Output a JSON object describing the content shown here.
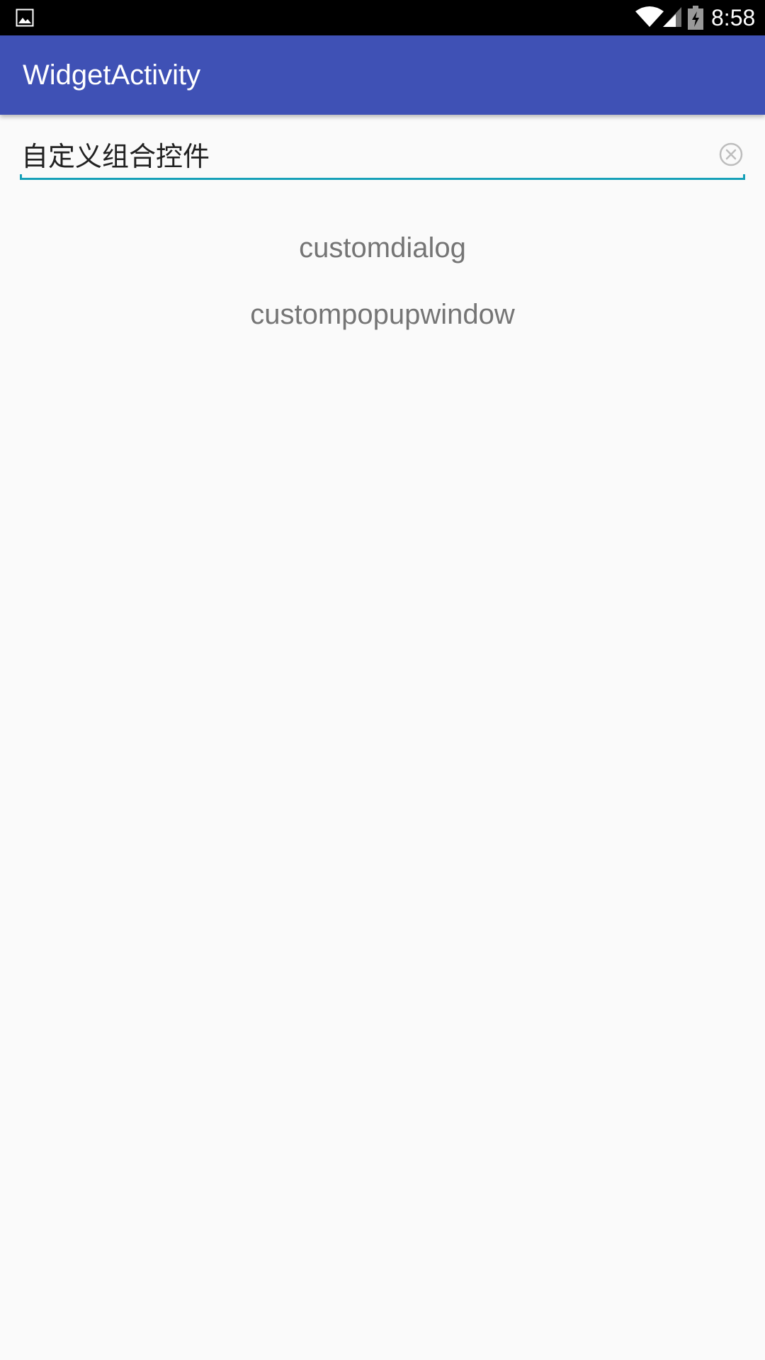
{
  "status_bar": {
    "time": "8:58",
    "icons": [
      "gallery-icon",
      "wifi-icon",
      "signal-icon",
      "battery-charging-icon"
    ],
    "background": "#000000"
  },
  "app_bar": {
    "title": "WidgetActivity",
    "color": "#3f51b5"
  },
  "search": {
    "value": "自定义组合控件",
    "accent_color": "#16a0b8",
    "clear_icon": "clear-circle-icon"
  },
  "list": {
    "items": [
      {
        "label": "customdialog"
      },
      {
        "label": "custompopupwindow"
      }
    ]
  }
}
